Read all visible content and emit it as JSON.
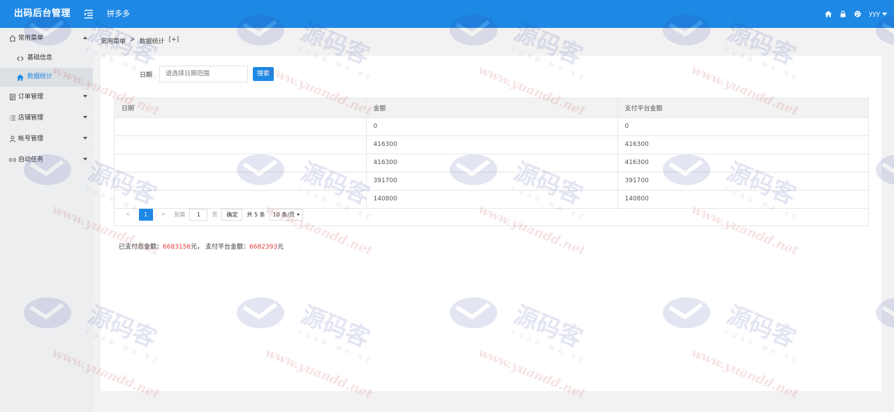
{
  "header": {
    "logo": "出码后台管理",
    "app_name": "拼多多",
    "user": "yyy"
  },
  "sidebar": {
    "groups": [
      {
        "label": "常用菜单",
        "expanded": true,
        "children": [
          {
            "label": "基础信息",
            "active": false
          },
          {
            "label": "数据统计",
            "active": true
          }
        ]
      },
      {
        "label": "订单管理"
      },
      {
        "label": "店铺管理"
      },
      {
        "label": "帐号管理"
      },
      {
        "label": "自动任务"
      }
    ]
  },
  "breadcrumb": {
    "root": "常用菜单",
    "sep": ">",
    "current": "数据统计",
    "extra": "[+]"
  },
  "filter": {
    "label": "日期",
    "placeholder": "请选择日期范围",
    "search_label": "搜索"
  },
  "table": {
    "columns": [
      "日期",
      "金额",
      "支付平台金额"
    ],
    "rows": [
      [
        "",
        "0",
        "0"
      ],
      [
        "",
        "416300",
        "416300"
      ],
      [
        "",
        "416300",
        "416300"
      ],
      [
        "",
        "391700",
        "391700"
      ],
      [
        "",
        "140800",
        "140800"
      ]
    ]
  },
  "pager": {
    "prev": "<",
    "current": "1",
    "next": ">",
    "goto_label": "到第",
    "goto_value": "1",
    "page_unit": "页",
    "confirm": "确定",
    "total": "共 5 条",
    "page_size": "10 条/页"
  },
  "summary": {
    "paid_label": "已支付总金额：",
    "paid_value": "6683156",
    "unit1": "元，",
    "platform_label": "支付平台金额：",
    "platform_value": "6682393",
    "unit2": "元"
  },
  "watermark": {
    "text_cn": "源码客",
    "text_en": "YUAN MA KE",
    "url": "www.yuandd.net"
  },
  "colors": {
    "primary": "#1e88e5",
    "sidebar_bg": "#eceef0",
    "highlight": "#e53935"
  }
}
